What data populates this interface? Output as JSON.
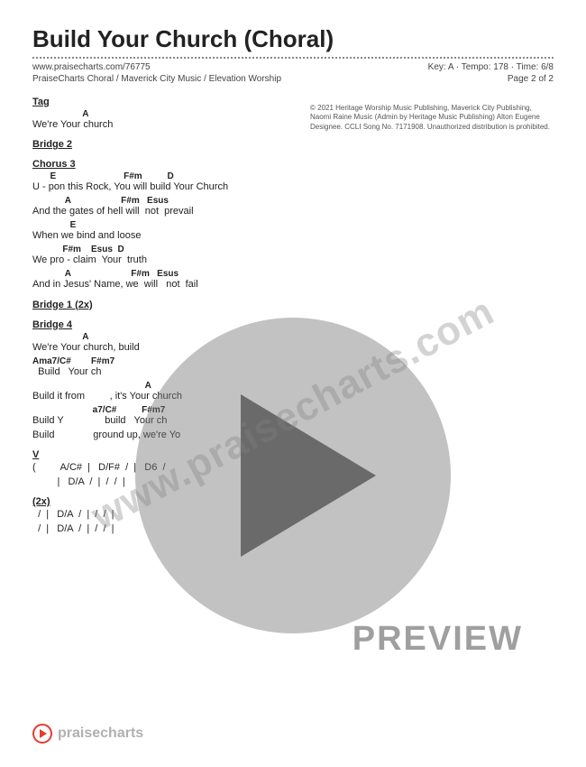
{
  "header": {
    "title": "Build Your Church (Choral)",
    "url": "www.praisecharts.com/76775",
    "artists": "PraiseCharts Choral / Maverick City Music / Elevation Worship",
    "key_tempo_time": "Key: A · Tempo: 178 · Time: 6/8",
    "page": "Page 2 of 2"
  },
  "copyright": "© 2021 Heritage Worship Music Publishing, Maverick City Publishing, Naomi Raine Music (Admin by Heritage Music Publishing) Alton Eugene Designee. CCLI Song No. 7171908. Unauthorized distribution is prohibited.",
  "sections": {
    "tag": {
      "label": "Tag",
      "chord": "                    A",
      "lyric": "We're Your church"
    },
    "bridge2": {
      "label": "Bridge 2"
    },
    "chorus3": {
      "label": "Chorus 3",
      "lines": [
        {
          "chord": "       E                           F#m          D",
          "lyric": "U - pon this Rock, You will build Your Church"
        },
        {
          "chord": "             A                    F#m   Esus",
          "lyric": "And the gates of hell will  not  prevail"
        },
        {
          "chord": "               E",
          "lyric": "When we bind and loose"
        },
        {
          "chord": "            F#m    Esus  D",
          "lyric": "We pro - claim  Your  truth"
        },
        {
          "chord": "             A                        F#m   Esus",
          "lyric": "And in Jesus' Name, we  will   not  fail"
        }
      ]
    },
    "bridge1_2x": {
      "label": "Bridge 1 (2x)"
    },
    "bridge4": {
      "label": "Bridge 4",
      "lines": [
        {
          "chord": "                    A",
          "lyric": "We're Your church, build"
        },
        {
          "chord": "Ama7/C#        F#m7",
          "lyric": "  Build   Your ch"
        },
        {
          "chord": "                                             A",
          "lyric": "Build it from         , it's Your church"
        },
        {
          "chord": "                        a7/C#          F#m7",
          "lyric": "Build Y               build   Your ch"
        },
        {
          "chord": "",
          "lyric": "Build              ground up, we're Yo"
        }
      ]
    },
    "vamp": {
      "label": "V",
      "lines": [
        "(         A/C#  |   D/F#  /  |   D6  /",
        "         |   D/A  /  |  /  /  |"
      ]
    },
    "outro": {
      "label": "(2x)",
      "lines": [
        "  /  |   D/A  /  |  /  /  |",
        "  /  |   D/A  /  |  /  /  |"
      ]
    }
  },
  "overlay": {
    "watermark": "www.praisecharts.com",
    "preview": "PREVIEW",
    "footer_text": "praisecharts"
  }
}
